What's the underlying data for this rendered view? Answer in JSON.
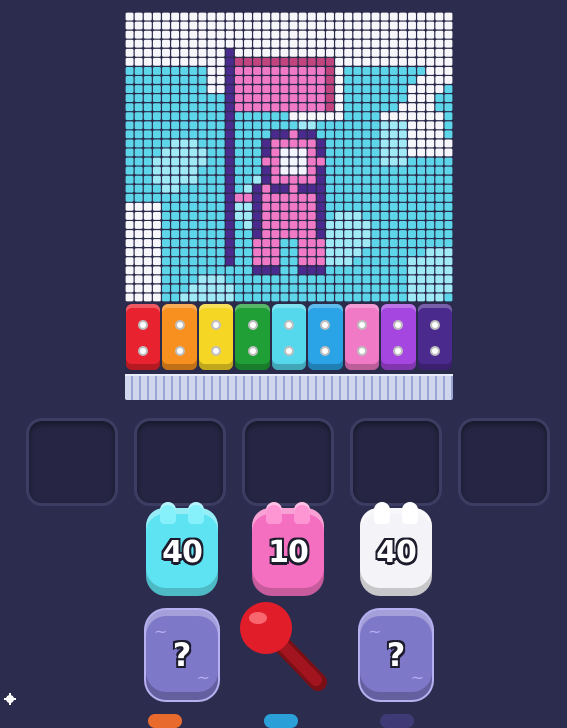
{
  "game": {
    "color_blocks": [
      {
        "color": "#e8222e",
        "name": "red"
      },
      {
        "color": "#f7901e",
        "name": "orange"
      },
      {
        "color": "#f6d625",
        "name": "yellow"
      },
      {
        "color": "#1f9f36",
        "name": "green"
      },
      {
        "color": "#55d8ec",
        "name": "cyan"
      },
      {
        "color": "#2aa4e6",
        "name": "blue"
      },
      {
        "color": "#f07ac6",
        "name": "pink"
      },
      {
        "color": "#a646e0",
        "name": "purple"
      },
      {
        "color": "#4b2a8e",
        "name": "indigo"
      }
    ],
    "empty_slots": 5,
    "shooters": [
      {
        "count": "40",
        "color": "#5ee3f2",
        "ear_color": "#86f0fb"
      },
      {
        "count": "10",
        "color": "#f46fbf",
        "ear_color": "#ff96d4"
      },
      {
        "count": "40",
        "color": "#f4f4f8",
        "ear_color": "#ffffff"
      }
    ],
    "mystery_shooters": [
      {
        "label": "?"
      },
      {
        "label": "?"
      }
    ],
    "lever_color": "#e11d2a",
    "bottom_peek_colors": [
      "#e86a2c",
      "#2a9fd8",
      "#3f3a75"
    ]
  },
  "icons": {
    "settings": "gear-icon",
    "lever": "lever-icon",
    "mystery": "question-icon"
  }
}
